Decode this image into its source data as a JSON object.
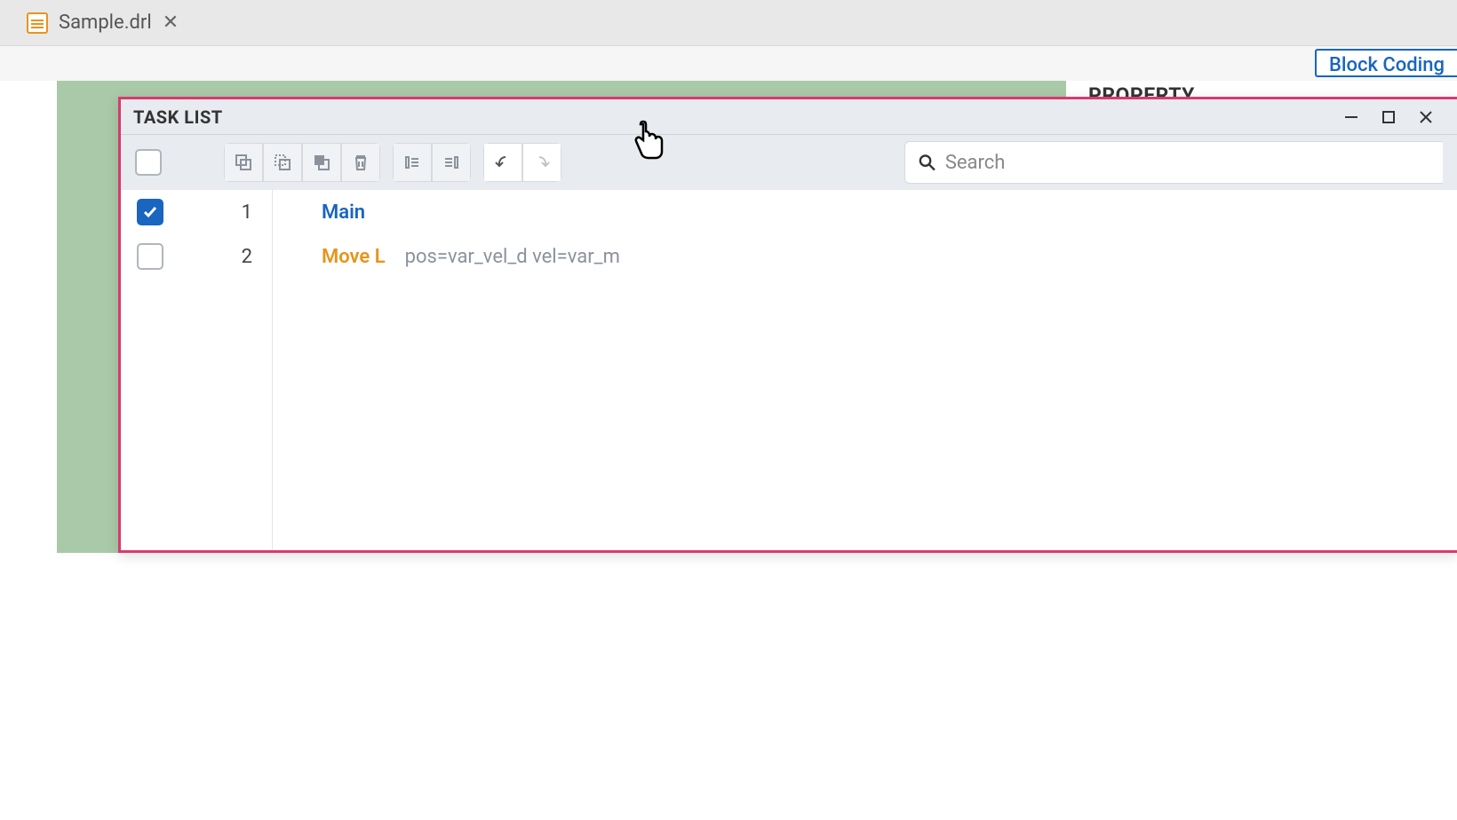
{
  "tab": {
    "filename": "Sample.drl"
  },
  "top_button": "Block Coding",
  "hidden_label": "PROPERTY",
  "panel": {
    "title": "TASK LIST",
    "search_placeholder": "Search",
    "rows": [
      {
        "num": "1",
        "cmd": "Main",
        "style": "main",
        "args": "",
        "checked": true
      },
      {
        "num": "2",
        "cmd": "Move L",
        "style": "move",
        "args": "pos=var_vel_d vel=var_m",
        "checked": false
      }
    ]
  }
}
